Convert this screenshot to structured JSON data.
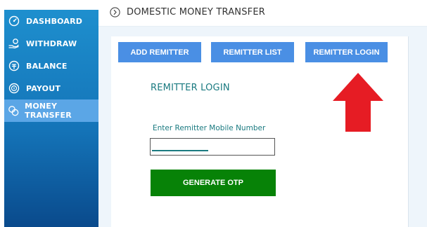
{
  "sidebar": {
    "items": [
      {
        "label": "DASHBOARD",
        "icon": "dashboard-gauge-icon",
        "active": false
      },
      {
        "label": "WITHDRAW",
        "icon": "hand-money-icon",
        "active": false
      },
      {
        "label": "BALANCE",
        "icon": "wallet-balance-icon",
        "active": false
      },
      {
        "label": "PAYOUT",
        "icon": "payout-coin-icon",
        "active": false
      },
      {
        "label": "MONEY TRANSFER",
        "icon": "money-transfer-icon",
        "active": true
      }
    ]
  },
  "header": {
    "title": "DOMESTIC MONEY TRANSFER",
    "icon": "chevron-right-circle-icon"
  },
  "tabs": [
    {
      "label": "ADD REMITTER"
    },
    {
      "label": "REMITTER LIST"
    },
    {
      "label": "REMITTER LOGIN"
    }
  ],
  "form": {
    "title": "REMITTER LOGIN",
    "mobile_label": "Enter Remitter Mobile Number",
    "mobile_value": "",
    "submit_label": "GENERATE OTP"
  },
  "annotation": {
    "icon": "red-up-arrow-icon"
  },
  "colors": {
    "sidebar": "#1474b8",
    "sidebar_active": "#5ba6e6",
    "tab_button": "#4a8fe4",
    "submit_button": "#078207",
    "accent_text": "#1a7a80",
    "arrow": "#e61c24"
  }
}
